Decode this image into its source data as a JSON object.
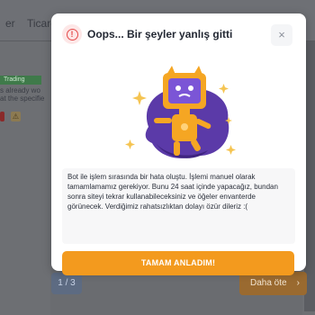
{
  "background": {
    "tabs": [
      "er",
      "Ticare"
    ],
    "status_badge": "Trading",
    "note_lines": [
      "s already wo",
      "at the specifie"
    ],
    "pager": "1 / 3",
    "next_button": "Daha öte",
    "bottom_text": "..."
  },
  "modal": {
    "title": "Oops... Bir şeyler yanlış gitti",
    "close_label": "×",
    "message": "Bot ile işlem sırasında bir hata oluştu. İşlemi manuel olarak tamamlamamız gerekiyor. Bunu 24 saat içinde yapacağız, bundan sonra siteyi tekrar kullanabileceksiniz ve öğeler envanterde görünecek. Verdiğimiz rahatsızlıktan dolayı özür dileriz :(",
    "confirm_button": "TAMAM ANLADIM!"
  },
  "colors": {
    "accent": "#f39a1e",
    "error": "#e54848",
    "illustration_purple": "#5b3aa8",
    "robot_orange": "#f5a623"
  }
}
